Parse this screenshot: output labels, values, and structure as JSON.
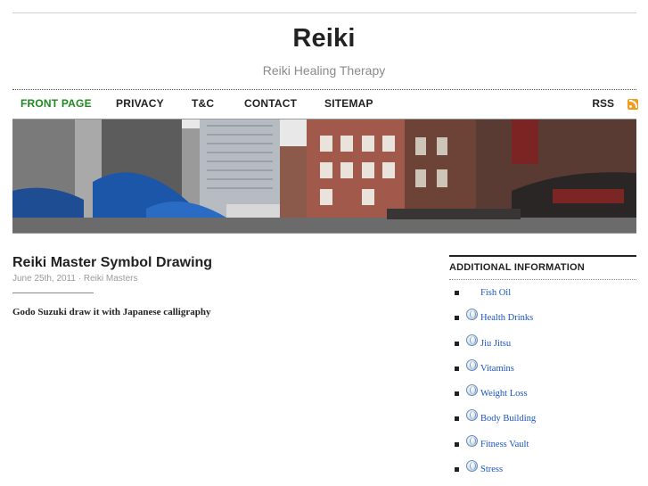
{
  "site": {
    "title": "Reiki",
    "description": "Reiki Healing Therapy"
  },
  "nav": {
    "items": [
      {
        "label": "FRONT PAGE",
        "active": true
      },
      {
        "label": "PRIVACY",
        "active": false
      },
      {
        "label": "T&C",
        "active": false
      },
      {
        "label": "CONTACT",
        "active": false
      },
      {
        "label": "SITEMAP",
        "active": false
      }
    ],
    "rss_label": "RSS",
    "active_color": "#1f8a1f"
  },
  "post": {
    "title": "Reiki Master Symbol Drawing",
    "date": "June 25th, 2011",
    "separator": " · ",
    "category": "Reiki Masters",
    "body": "Godo Suzuki draw it with Japanese calligraphy"
  },
  "sidebar": {
    "heading": "ADDITIONAL INFORMATION",
    "links": [
      {
        "label": "Fish Oil",
        "icon": "none"
      },
      {
        "label": "Health Drinks",
        "icon": "globe-icon"
      },
      {
        "label": "Jiu Jitsu",
        "icon": "globe-icon"
      },
      {
        "label": "Vitamins",
        "icon": "globe-icon"
      },
      {
        "label": "Weight Loss",
        "icon": "globe-icon"
      },
      {
        "label": "Body Building",
        "icon": "globe-icon"
      },
      {
        "label": "Fitness Vault",
        "icon": "globe-icon"
      },
      {
        "label": "Stress",
        "icon": "globe-icon"
      }
    ],
    "link_color": "#1a55c4"
  }
}
